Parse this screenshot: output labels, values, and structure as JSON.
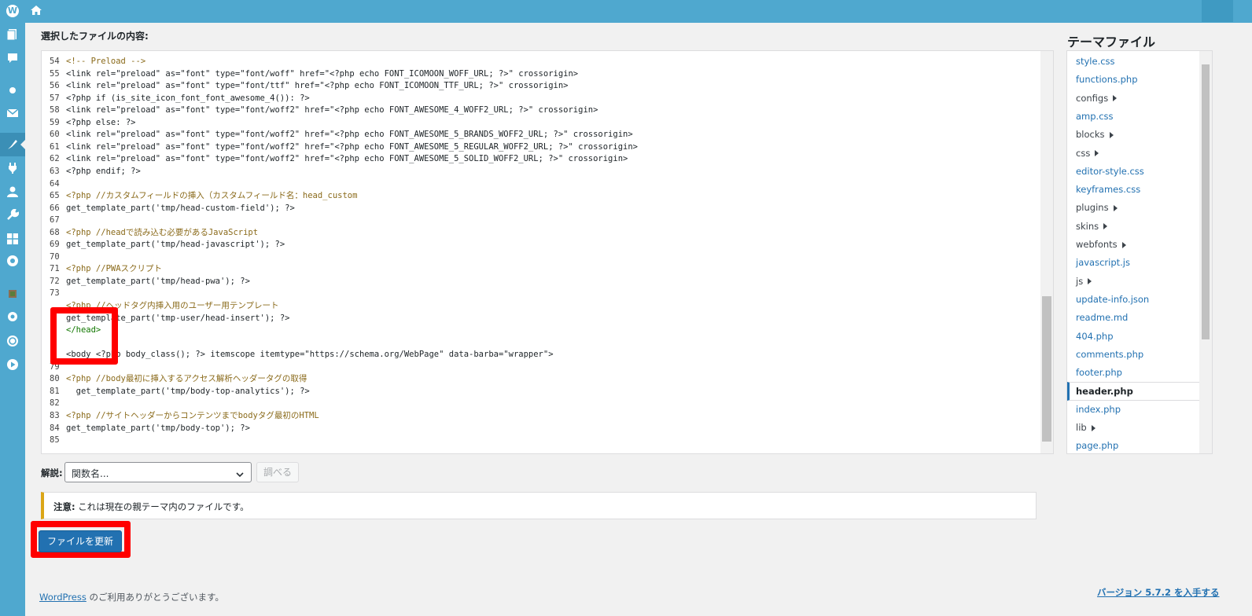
{
  "admin_bar": {
    "wp_logo": "W",
    "home_icon": "home-icon"
  },
  "sidebar": {
    "icons": [
      "posts-icon",
      "comments-icon",
      "media-icon",
      "mail-icon",
      "appearance-icon",
      "plugins-icon",
      "users-icon",
      "tools-icon",
      "settings-grid-icon",
      "gear-badge-icon",
      "photo-icon",
      "gear-icon",
      "refresh-icon",
      "play-icon"
    ]
  },
  "editor": {
    "heading": "選択したファイルの内容:",
    "lines": [
      {
        "n": "54",
        "text": "<!-- Preload -->",
        "kind": "cmt"
      },
      {
        "n": "55",
        "text": "<link rel=\"preload\" as=\"font\" type=\"font/woff\" href=\"<?php echo FONT_ICOMOON_WOFF_URL; ?>\" crossorigin>",
        "kind": "code"
      },
      {
        "n": "56",
        "text": "<link rel=\"preload\" as=\"font\" type=\"font/ttf\" href=\"<?php echo FONT_ICOMOON_TTF_URL; ?>\" crossorigin>",
        "kind": "code"
      },
      {
        "n": "57",
        "text": "<?php if (is_site_icon_font_font_awesome_4()): ?>",
        "kind": "code"
      },
      {
        "n": "58",
        "text": "<link rel=\"preload\" as=\"font\" type=\"font/woff2\" href=\"<?php echo FONT_AWESOME_4_WOFF2_URL; ?>\" crossorigin>",
        "kind": "code"
      },
      {
        "n": "59",
        "text": "<?php else: ?>",
        "kind": "code"
      },
      {
        "n": "60",
        "text": "<link rel=\"preload\" as=\"font\" type=\"font/woff2\" href=\"<?php echo FONT_AWESOME_5_BRANDS_WOFF2_URL; ?>\" crossorigin>",
        "kind": "code"
      },
      {
        "n": "61",
        "text": "<link rel=\"preload\" as=\"font\" type=\"font/woff2\" href=\"<?php echo FONT_AWESOME_5_REGULAR_WOFF2_URL; ?>\" crossorigin>",
        "kind": "code"
      },
      {
        "n": "62",
        "text": "<link rel=\"preload\" as=\"font\" type=\"font/woff2\" href=\"<?php echo FONT_AWESOME_5_SOLID_WOFF2_URL; ?>\" crossorigin>",
        "kind": "code"
      },
      {
        "n": "63",
        "text": "<?php endif; ?>",
        "kind": "code"
      },
      {
        "n": "64",
        "text": "",
        "kind": "code"
      },
      {
        "n": "65",
        "text": "<?php //カスタムフィールドの挿入（カスタムフィールド名：head_custom",
        "kind": "cmt"
      },
      {
        "n": "66",
        "text": "get_template_part('tmp/head-custom-field'); ?>",
        "kind": "code"
      },
      {
        "n": "67",
        "text": "",
        "kind": "code"
      },
      {
        "n": "68",
        "text": "<?php //headで読み込む必要があるJavaScript",
        "kind": "cmt"
      },
      {
        "n": "69",
        "text": "get_template_part('tmp/head-javascript'); ?>",
        "kind": "code"
      },
      {
        "n": "70",
        "text": "",
        "kind": "code"
      },
      {
        "n": "71",
        "text": "<?php //PWAスクリプト",
        "kind": "cmt"
      },
      {
        "n": "72",
        "text": "get_template_part('tmp/head-pwa'); ?>",
        "kind": "code"
      },
      {
        "n": "73",
        "text": "",
        "kind": "code"
      },
      {
        "n": "",
        "text": "<?php //ヘッドタグ内挿入用のユーザー用テンプレート",
        "kind": "cmt"
      },
      {
        "n": "",
        "text": "get_template_part('tmp-user/head-insert'); ?>",
        "kind": "code"
      },
      {
        "n": "",
        "text": "</head>",
        "kind": "tag"
      },
      {
        "n": "",
        "text": "",
        "kind": "code"
      },
      {
        "n": "",
        "text": "<body <?php body_class(); ?> itemscope itemtype=\"https://schema.org/WebPage\" data-barba=\"wrapper\">",
        "kind": "code"
      },
      {
        "n": "79",
        "text": "",
        "kind": "code"
      },
      {
        "n": "80",
        "text": "<?php //body最初に挿入するアクセス解析ヘッダータグの取得",
        "kind": "cmt"
      },
      {
        "n": "81",
        "text": "  get_template_part('tmp/body-top-analytics'); ?>",
        "kind": "code"
      },
      {
        "n": "82",
        "text": "",
        "kind": "code"
      },
      {
        "n": "83",
        "text": "<?php //サイトヘッダーからコンテンツまでbodyタグ最初のHTML",
        "kind": "cmt"
      },
      {
        "n": "84",
        "text": "get_template_part('tmp/body-top'); ?>",
        "kind": "code"
      },
      {
        "n": "85",
        "text": "",
        "kind": "code"
      }
    ]
  },
  "theme_files": {
    "title": "テーマファイル",
    "items": [
      {
        "label": "style.css",
        "type": "file"
      },
      {
        "label": "functions.php",
        "type": "file"
      },
      {
        "label": "configs",
        "type": "folder"
      },
      {
        "label": "amp.css",
        "type": "file"
      },
      {
        "label": "blocks",
        "type": "folder"
      },
      {
        "label": "css",
        "type": "folder"
      },
      {
        "label": "editor-style.css",
        "type": "file"
      },
      {
        "label": "keyframes.css",
        "type": "file"
      },
      {
        "label": "plugins",
        "type": "folder"
      },
      {
        "label": "skins",
        "type": "folder"
      },
      {
        "label": "webfonts",
        "type": "folder"
      },
      {
        "label": "javascript.js",
        "type": "file"
      },
      {
        "label": "js",
        "type": "folder"
      },
      {
        "label": "update-info.json",
        "type": "file"
      },
      {
        "label": "readme.md",
        "type": "file"
      },
      {
        "label": "404.php",
        "type": "file"
      },
      {
        "label": "comments.php",
        "type": "file"
      },
      {
        "label": "footer.php",
        "type": "file"
      },
      {
        "label": "header.php",
        "type": "current"
      },
      {
        "label": "index.php",
        "type": "file"
      },
      {
        "label": "lib",
        "type": "folder"
      },
      {
        "label": "page.php",
        "type": "file"
      }
    ]
  },
  "docs": {
    "label": "解説:",
    "select_value": "関数名...",
    "lookup_button": "調べる"
  },
  "notice": {
    "bold": "注意:",
    "text": " これは現在の親テーマ内のファイルです。"
  },
  "update_button": "ファイルを更新",
  "footer": {
    "link": "WordPress",
    "thanks": " のご利用ありがとうございます。",
    "version": "バージョン 5.7.2 を入手する"
  },
  "colors": {
    "admin_bar": "#4fa8cf",
    "primary": "#2271b1",
    "highlight": "#ff0000",
    "notice_border": "#dba617"
  }
}
